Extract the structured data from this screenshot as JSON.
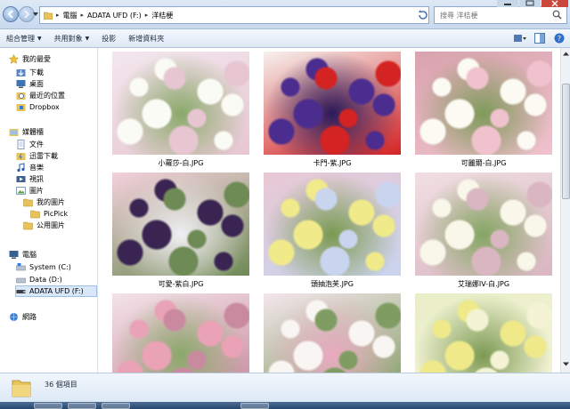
{
  "window": {
    "breadcrumb": [
      "電腦",
      "ADATA UFD (F:)",
      "洋桔梗"
    ],
    "search_placeholder": "搜尋 洋桔梗"
  },
  "toolbar": {
    "organize": "組合管理",
    "share": "共用對象",
    "slideshow": "投影",
    "new_folder": "新增資料夾"
  },
  "sidebar": {
    "favorites_header": "我的最愛",
    "favorites": [
      "下載",
      "桌面",
      "最近的位置",
      "Dropbox"
    ],
    "libraries_header": "媒體櫃",
    "libraries": [
      "文件",
      "迅雷下載",
      "音樂",
      "視訊",
      "圖片"
    ],
    "pictures_children": [
      "我的圖片",
      "公用圖片"
    ],
    "my_pictures_children": [
      "PicPick"
    ],
    "computer_header": "電腦",
    "drives": [
      "System (C:)",
      "Data (D:)",
      "ADATA UFD (F:)"
    ],
    "network_header": "網路"
  },
  "files": [
    {
      "name": "小蘿莎-白.JPG",
      "palette": [
        "#f3e7ee",
        "#fbfbf6",
        "#8aa96a",
        "#e7c6d2"
      ]
    },
    {
      "name": "卡門-紫.JPG",
      "palette": [
        "#f6f1ee",
        "#4b2c8f",
        "#2a1a5a",
        "#d32323"
      ]
    },
    {
      "name": "可麗爾-白.JPG",
      "palette": [
        "#d8a3ae",
        "#fbfaf3",
        "#7e9a5a",
        "#f0c2cd"
      ]
    },
    {
      "name": "可愛-紫白.JPG",
      "palette": [
        "#f4d1dc",
        "#3a2452",
        "#efeff2",
        "#6e8a55"
      ]
    },
    {
      "name": "頭抽泡芙.JPG",
      "palette": [
        "#e9c8d4",
        "#f0ea8a",
        "#7a9a52",
        "#c9d4ee"
      ]
    },
    {
      "name": "艾瑞娜IV-白.JPG",
      "palette": [
        "#f1dfe3",
        "#f8f7ea",
        "#85a563",
        "#d9b6c1"
      ]
    },
    {
      "name": "",
      "palette": [
        "#f3e3e8",
        "#e9a2b6",
        "#8ba86b",
        "#c98aa0"
      ]
    },
    {
      "name": "",
      "palette": [
        "#f4e6ec",
        "#f8f5f2",
        "#e9aac0",
        "#7f9d62"
      ]
    },
    {
      "name": "",
      "palette": [
        "#e8eec8",
        "#efe98a",
        "#7c9a54",
        "#f5f3d6"
      ]
    }
  ],
  "status": {
    "count": "36 個項目"
  }
}
